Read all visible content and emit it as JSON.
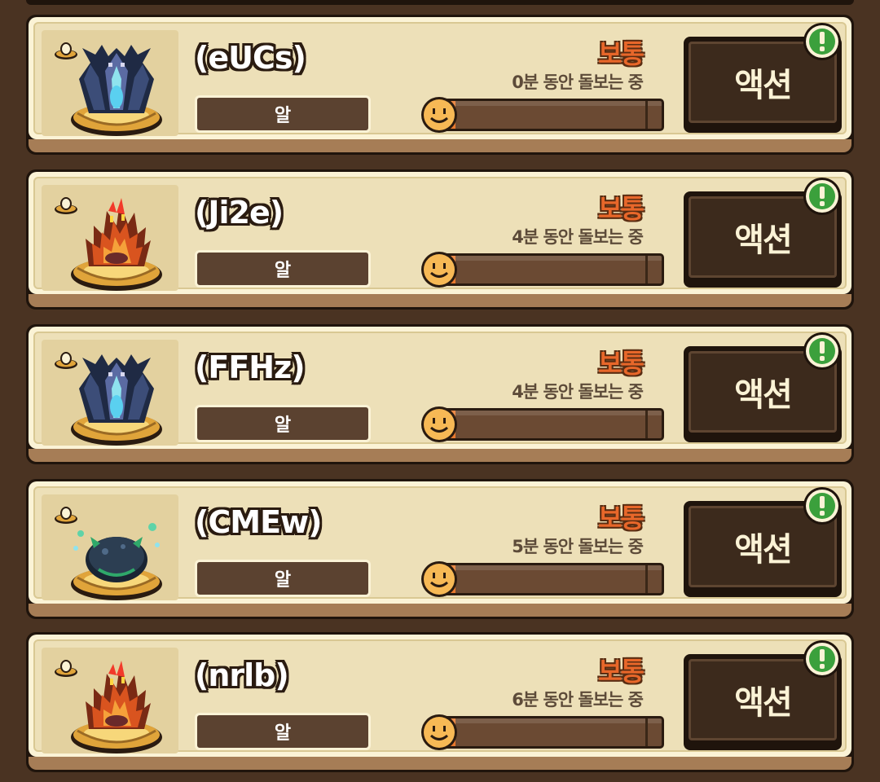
{
  "pets": [
    {
      "name": "(eUCs)",
      "stage": "알",
      "mood": "보통",
      "care_time": "0분 동안 돌보는 중",
      "care_progress": 0.05,
      "creature": "dark-dragon-egg",
      "action_label": "액션"
    },
    {
      "name": "(Ji2e)",
      "stage": "알",
      "mood": "보통",
      "care_time": "4분 동안 돌보는 중",
      "care_progress": 0.05,
      "creature": "fire-egg",
      "action_label": "액션"
    },
    {
      "name": "(FFHz)",
      "stage": "알",
      "mood": "보통",
      "care_time": "4분 동안 돌보는 중",
      "care_progress": 0.05,
      "creature": "dark-dragon-egg",
      "action_label": "액션"
    },
    {
      "name": "(CMEw)",
      "stage": "알",
      "mood": "보통",
      "care_time": "5분 동안 돌보는 중",
      "care_progress": 0.05,
      "creature": "slime-egg",
      "action_label": "액션"
    },
    {
      "name": "(nrlb)",
      "stage": "알",
      "mood": "보통",
      "care_time": "6분 동안 돌보는 중",
      "care_progress": 0.05,
      "creature": "fire-egg",
      "action_label": "액션"
    }
  ],
  "colors": {
    "background": "#4a3322",
    "card": "#ede0b8",
    "mood": "#e8672a",
    "progress_fill": "#e97a2e",
    "alert": "#3ba03c"
  },
  "icons": {
    "nest": "nest-icon",
    "smiley": "smiley-face-icon",
    "alert": "exclamation-alert-icon"
  }
}
